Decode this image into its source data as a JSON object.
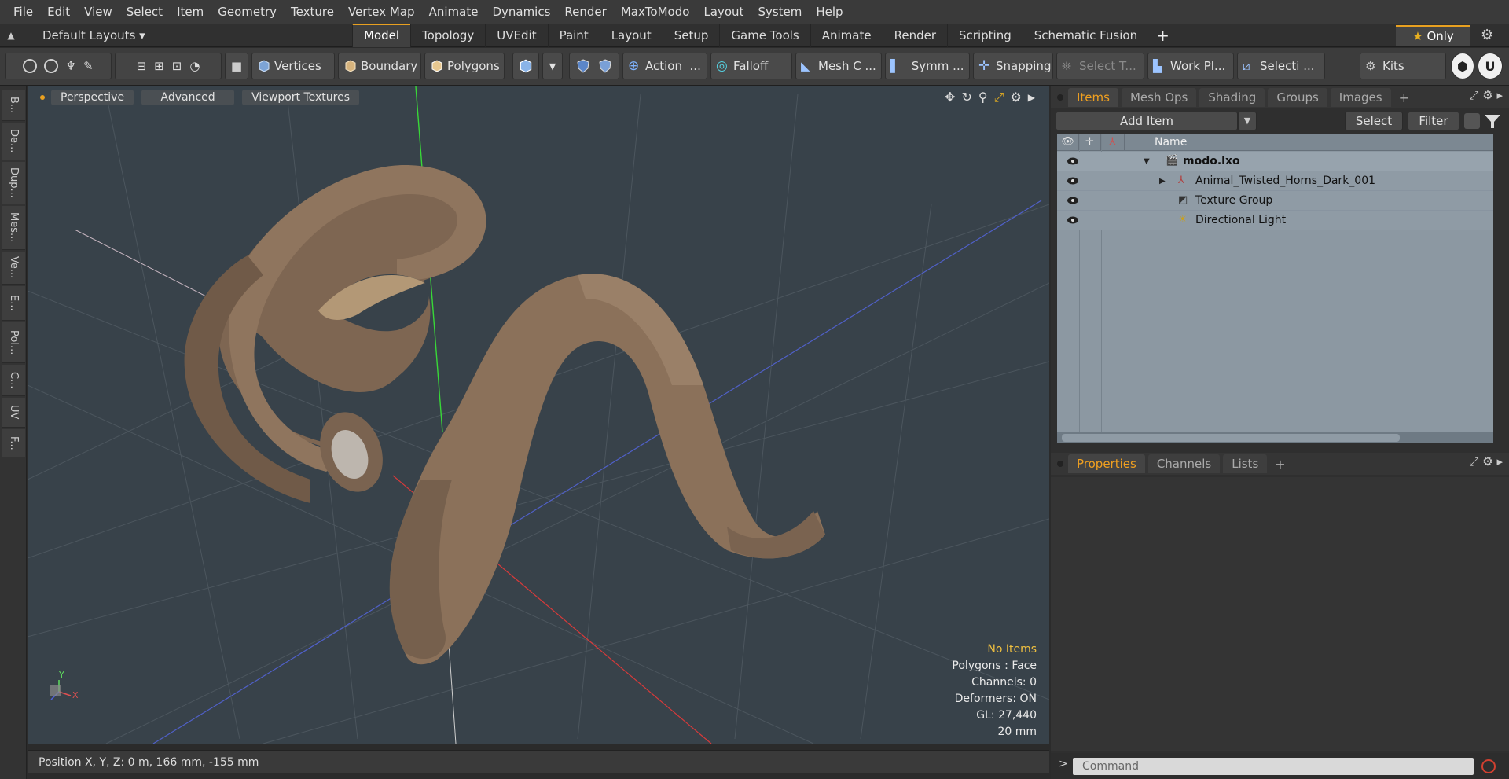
{
  "menu": [
    "File",
    "Edit",
    "View",
    "Select",
    "Item",
    "Geometry",
    "Texture",
    "Vertex Map",
    "Animate",
    "Dynamics",
    "Render",
    "MaxToModo",
    "Layout",
    "System",
    "Help"
  ],
  "layouts": {
    "label": "Default Layouts ▾"
  },
  "tabs": [
    "Model",
    "Topology",
    "UVEdit",
    "Paint",
    "Layout",
    "Setup",
    "Game Tools",
    "Animate",
    "Render",
    "Scripting",
    "Schematic Fusion"
  ],
  "active_tab": "Model",
  "only_button": "Only",
  "toolbar": {
    "vertices": "Vertices",
    "boundary": "Boundary",
    "polygons": "Polygons",
    "action": "Action",
    "action_more": "...",
    "falloff": "Falloff",
    "mesh": "Mesh C ...",
    "symm": "Symm ...",
    "snapping": "Snapping",
    "select_t": "Select T...",
    "workpl": "Work Pl...",
    "selecti": "Selecti ...",
    "kits": "Kits"
  },
  "left_strip": [
    "B...",
    "De...",
    "Dup...",
    "Mes...",
    "Ve...",
    "E...",
    "Pol...",
    "C...",
    "UV",
    "F..."
  ],
  "viewport": {
    "buttons": [
      "Perspective",
      "Advanced",
      "Viewport Textures"
    ],
    "info": {
      "no_items": "No Items",
      "polygons": "Polygons : Face",
      "channels": "Channels: 0",
      "deformers": "Deformers: ON",
      "gl": "GL: 27,440",
      "scale": "20 mm"
    }
  },
  "status": "Position X, Y, Z:   0 m, 166 mm, -155 mm",
  "panel_top": {
    "tabs": [
      "Items",
      "Mesh Ops",
      "Shading",
      "Groups",
      "Images"
    ],
    "active": "Items"
  },
  "items_toolbar": {
    "add_item": "Add Item",
    "select": "Select",
    "filter": "Filter"
  },
  "items_header": {
    "name": "Name"
  },
  "items": [
    {
      "label": "modo.lxo",
      "bold": true
    },
    {
      "label": "Animal_Twisted_Horns_Dark_001",
      "bold": false
    },
    {
      "label": "Texture Group",
      "bold": false
    },
    {
      "label": "Directional Light",
      "bold": false
    }
  ],
  "panel_bottom": {
    "tabs": [
      "Properties",
      "Channels",
      "Lists"
    ],
    "active": "Properties"
  },
  "command": {
    "placeholder": "Command"
  },
  "colors": {
    "accent": "#e8a020",
    "viewport_bg": "#38424a",
    "horn": "#8a7058",
    "list_bg": "#8c98a2"
  }
}
